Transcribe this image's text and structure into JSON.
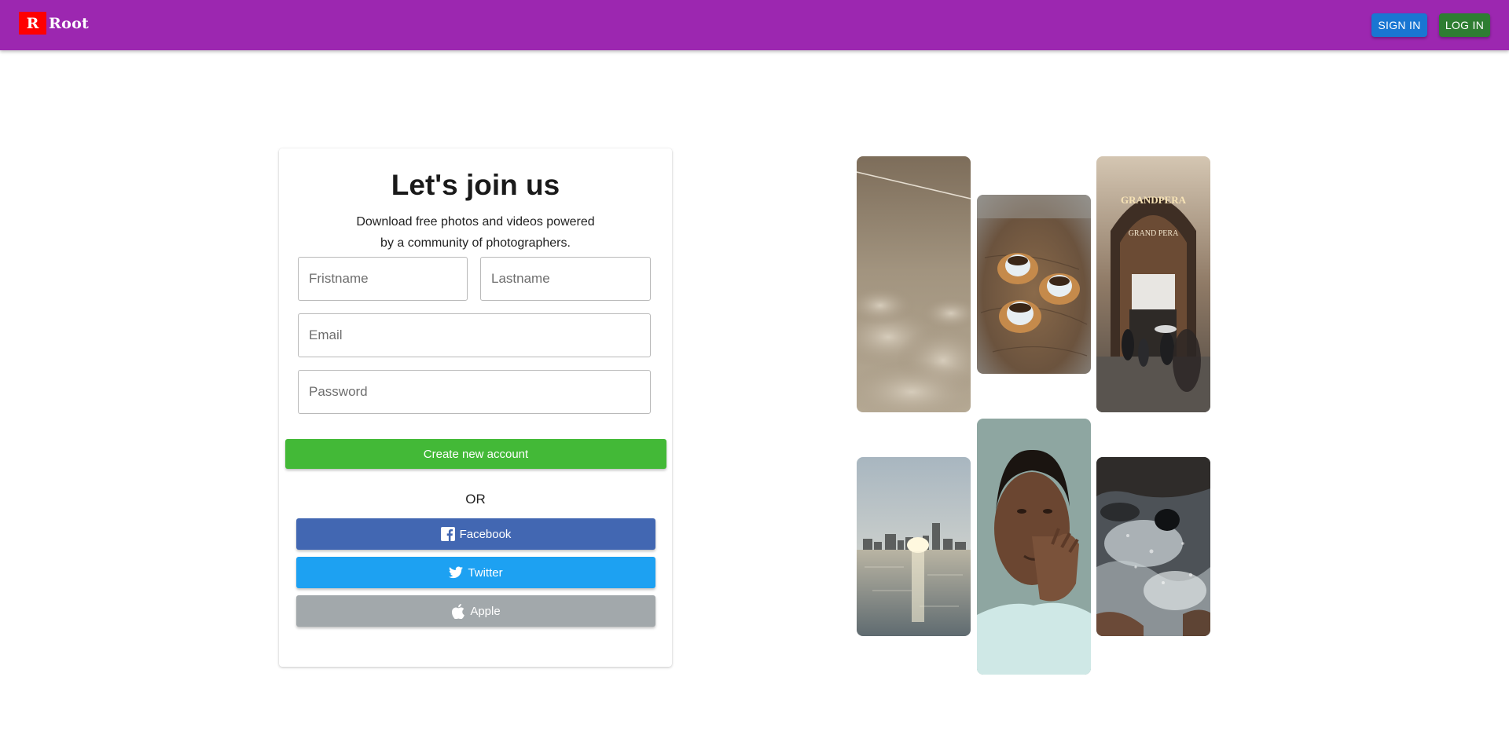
{
  "header": {
    "logo_letter": "R",
    "brand": "Root",
    "signin_label": "SIGN IN",
    "login_label": "LOG IN"
  },
  "signup": {
    "title": "Let's join us",
    "subtitle_line1": "Download free photos and videos powered",
    "subtitle_line2": "by a community of photographers.",
    "firstname_placeholder": "Fristname",
    "lastname_placeholder": "Lastname",
    "email_placeholder": "Email",
    "password_placeholder": "Password",
    "create_label": "Create new account",
    "or_label": "OR",
    "facebook_label": "Facebook",
    "twitter_label": "Twitter",
    "apple_label": "Apple"
  },
  "collage": {
    "arcade_sign_text": "GRANDPERA",
    "arcade_sub_text": "GRAND PERA"
  },
  "colors": {
    "header": "#9c27b0",
    "logo": "#ff0000",
    "signin": "#1976d2",
    "login": "#2e7d32",
    "create": "#43b937",
    "facebook": "#4267b2",
    "twitter": "#1da1f2",
    "apple": "#a2a8ab"
  },
  "icons": {
    "facebook": "facebook-icon",
    "twitter": "twitter-icon",
    "apple": "apple-icon"
  }
}
